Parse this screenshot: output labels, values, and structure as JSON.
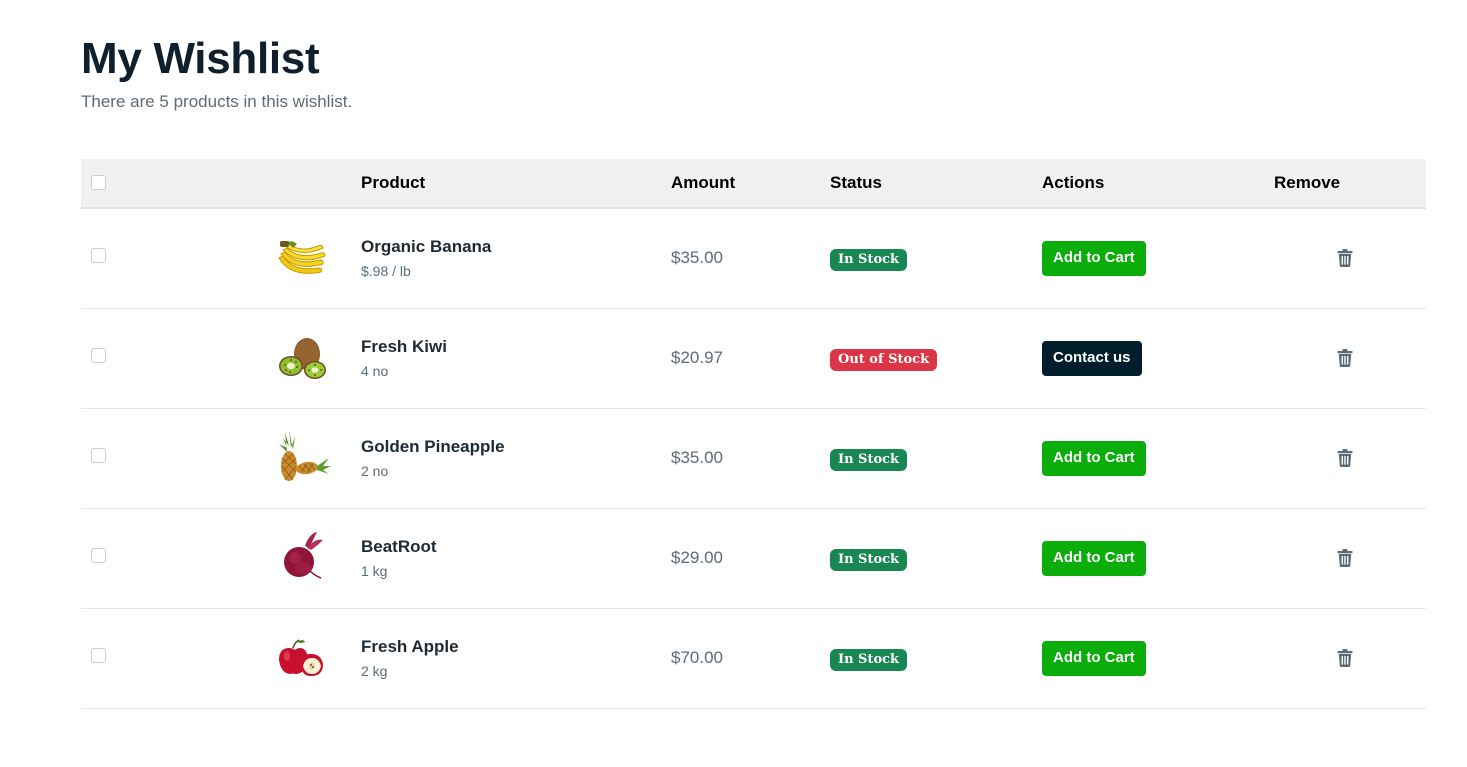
{
  "page": {
    "title": "My Wishlist",
    "subtitle": "There are 5 products in this wishlist."
  },
  "table": {
    "headers": {
      "product": "Product",
      "amount": "Amount",
      "status": "Status",
      "actions": "Actions",
      "remove": "Remove"
    },
    "rows": [
      {
        "name": "Organic Banana",
        "unit": "$.98 / lb",
        "amount": "$35.00",
        "status": "In Stock",
        "status_type": "in",
        "action": "Add to Cart",
        "action_type": "green",
        "image_icon": "banana-image"
      },
      {
        "name": "Fresh Kiwi",
        "unit": "4 no",
        "amount": "$20.97",
        "status": "Out of Stock",
        "status_type": "out",
        "action": "Contact us",
        "action_type": "dark",
        "image_icon": "kiwi-image"
      },
      {
        "name": "Golden Pineapple",
        "unit": "2 no",
        "amount": "$35.00",
        "status": "In Stock",
        "status_type": "in",
        "action": "Add to Cart",
        "action_type": "green",
        "image_icon": "pineapple-image"
      },
      {
        "name": "BeatRoot",
        "unit": "1 kg",
        "amount": "$29.00",
        "status": "In Stock",
        "status_type": "in",
        "action": "Add to Cart",
        "action_type": "green",
        "image_icon": "beetroot-image"
      },
      {
        "name": "Fresh Apple",
        "unit": "2 kg",
        "amount": "$70.00",
        "status": "In Stock",
        "status_type": "in",
        "action": "Add to Cart",
        "action_type": "green",
        "image_icon": "apple-image"
      }
    ]
  },
  "colors": {
    "title": "#0f1f2c",
    "in_stock": "#198754",
    "out_of_stock": "#dc3545",
    "add_to_cart": "#0aad0a",
    "contact_us": "#001e2b",
    "header_bg": "#f0f2f1"
  },
  "icons": {
    "remove": "trash-icon"
  }
}
